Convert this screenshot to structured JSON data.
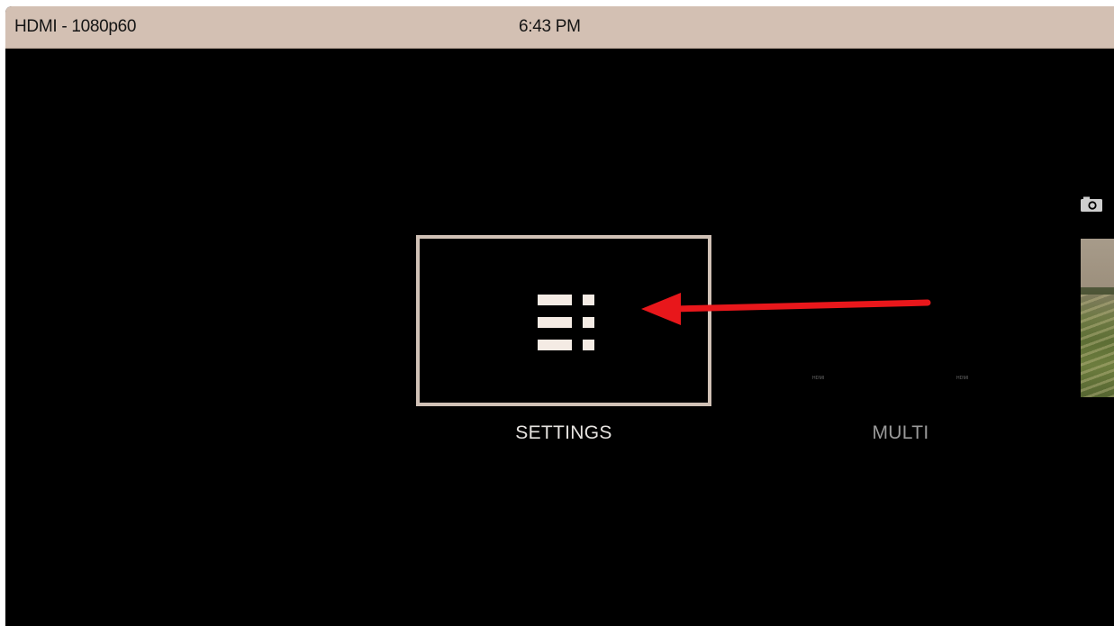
{
  "status_bar": {
    "input": "HDMI - 1080p60",
    "time": "6:43 PM"
  },
  "menu": {
    "settings": {
      "label": "SETTINGS",
      "icon": "settings-list-icon"
    },
    "multi": {
      "label": "MULTI",
      "mini_labels": [
        "HDMI",
        "HDMI"
      ]
    },
    "capture": {
      "icon": "camera-icon"
    }
  },
  "annotation": {
    "arrow_color": "#e8171b"
  },
  "colors": {
    "background": "#000000",
    "status_bar": "#d3c0b3",
    "selected_border": "#d0c1b6",
    "icon": "#f4ebe4"
  }
}
